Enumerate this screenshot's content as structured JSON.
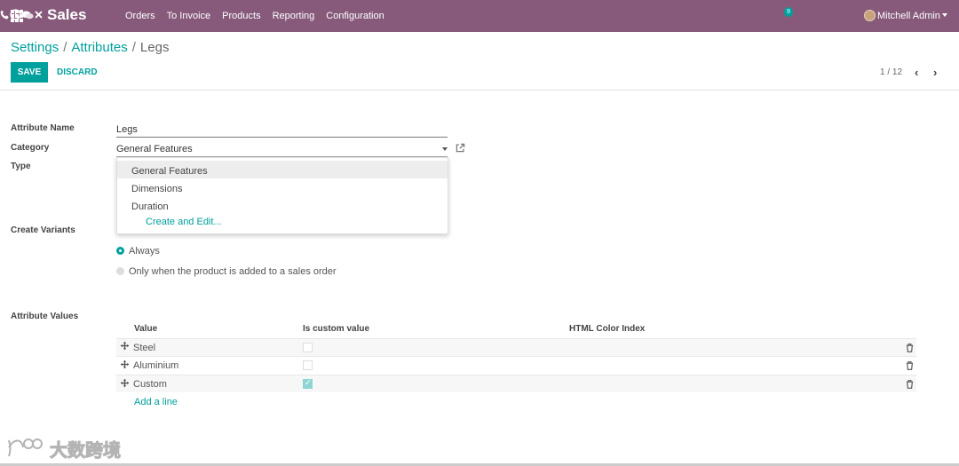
{
  "navbar": {
    "app_name": "Sales",
    "menu": [
      "Orders",
      "To Invoice",
      "Products",
      "Reporting",
      "Configuration"
    ],
    "activity_count": "9",
    "user_name": "Mitchell Admin",
    "color": "#875a7b"
  },
  "breadcrumb": {
    "items": [
      "Settings",
      "Attributes"
    ],
    "current": "Legs",
    "separator": "/"
  },
  "actions": {
    "save": "SAVE",
    "discard": "DISCARD"
  },
  "pager": {
    "value": "1 / 12"
  },
  "form": {
    "attribute_name_label": "Attribute Name",
    "attribute_name_value": "Legs",
    "category_label": "Category",
    "category_value": "General Features",
    "type_label": "Type",
    "create_variants_label": "Create Variants",
    "variants_options": [
      "Always",
      "Only when the product is added to a sales order"
    ],
    "variants_selected": "Always",
    "attribute_values_label": "Attribute Values"
  },
  "category_dropdown": {
    "options": [
      "General Features",
      "Dimensions",
      "Duration"
    ],
    "highlighted": "General Features",
    "create_label": "Create and Edit..."
  },
  "values_table": {
    "columns": [
      "Value",
      "Is custom value",
      "HTML Color Index"
    ],
    "rows": [
      {
        "value": "Steel",
        "is_custom": false
      },
      {
        "value": "Aluminium",
        "is_custom": false
      },
      {
        "value": "Custom",
        "is_custom": true
      }
    ],
    "add_line": "Add a line"
  },
  "watermark": {
    "text": "大数跨境"
  },
  "colors": {
    "accent": "#00a09d",
    "primary": "#875a7b"
  }
}
